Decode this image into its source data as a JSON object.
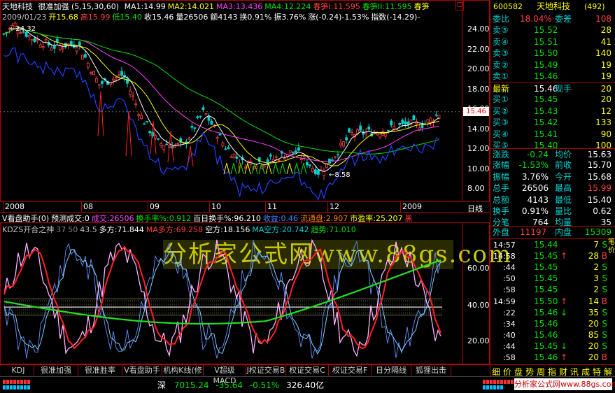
{
  "stock": {
    "name": "天地科技",
    "indicator": "很准加强 (5,15,30,60)",
    "code": "600582",
    "code_count": "(492)",
    "ma": [
      {
        "label": "MA1:14.99",
        "color": "#ffffff"
      },
      {
        "label": "MA2:14.021",
        "color": "#ffff00"
      },
      {
        "label": "MA3:13.436",
        "color": "#ff40ff"
      },
      {
        "label": "MA4:12.224",
        "color": "#00e000"
      },
      {
        "label": "春笋I:11.595",
        "color": "#ff4040"
      },
      {
        "label": "春笋II:11.595",
        "color": "#00e000"
      },
      {
        "label": "春笋",
        "color": "#ffff00"
      }
    ],
    "info_line": [
      {
        "t": "2009/01/23",
        "c": "#c0c0c0"
      },
      {
        "t": "开15.68",
        "c": "#ffff00"
      },
      {
        "t": "高15.99",
        "c": "#ff4040"
      },
      {
        "t": "低15.40",
        "c": "#00e000"
      },
      {
        "t": "收15.46",
        "c": "#ffffff"
      },
      {
        "t": "量26506",
        "c": "#ffffff"
      },
      {
        "t": "额4143",
        "c": "#ffffff"
      },
      {
        "t": "换0.91%",
        "c": "#ffffff"
      },
      {
        "t": "振3.76%",
        "c": "#ffffff"
      },
      {
        "t": "涨(-0.24)-1.53%",
        "c": "#ffffff"
      },
      {
        "t": "指数(-14.29)-",
        "c": "#ffffff"
      }
    ],
    "high_marker": "24.32",
    "low_marker": "8.58",
    "current_price_tag": "15.46",
    "price_ticks": [
      "24.00",
      "22.00",
      "20.00",
      "18.00",
      "16.00",
      "14.00",
      "12.00",
      "10.00",
      "8.00"
    ],
    "date_labels": [
      "2008",
      "08",
      "09",
      "10",
      "11",
      "12",
      "2009"
    ],
    "period_label": "日线",
    "watermark": "分析家公式网www.88gs.com"
  },
  "indicator1": {
    "legend": [
      {
        "t": "V看盘助手(0)",
        "c": "#ffffff"
      },
      {
        "t": "预测成交:0",
        "c": "#ffffff"
      },
      {
        "t": "成交:26506",
        "c": "#ff40ff"
      },
      {
        "t": "换手率%:0.912",
        "c": "#00e000"
      },
      {
        "t": "百日换手%:96.210",
        "c": "#ffffff"
      },
      {
        "t": "收益:0.46",
        "c": "#4080ff"
      },
      {
        "t": "流通盘:2.907",
        "c": "#ff8000"
      },
      {
        "t": "市盈率:25.207",
        "c": "#ffff00"
      },
      {
        "t": "黑",
        "c": "#ff4040"
      }
    ]
  },
  "indicator2": {
    "legend": [
      {
        "t": "KDZS开合之神",
        "c": "#c0c0c0"
      },
      {
        "t": "37",
        "c": "#808080"
      },
      {
        "t": "50",
        "c": "#808080"
      },
      {
        "t": "43.5",
        "c": "#c0c0c0"
      },
      {
        "t": "多方:71.844",
        "c": "#ffffff"
      },
      {
        "t": "MA多方:69.258",
        "c": "#ff4040"
      },
      {
        "t": "空方:18.156",
        "c": "#ffffff"
      },
      {
        "t": "MA空方:20.742",
        "c": "#00d0d0"
      },
      {
        "t": "趋势:71.010",
        "c": "#00e000"
      }
    ],
    "ticks": [
      "60.00",
      "40.00",
      "20.00"
    ]
  },
  "quote": {
    "wei_bi_label": "委比",
    "wei_bi_value": "18.04%",
    "wei_cha_label": "委差",
    "wei_cha_value": "108",
    "sell": [
      {
        "label": "卖⑤",
        "price": "15.52",
        "vol": "28"
      },
      {
        "label": "卖④",
        "price": "15.51",
        "vol": "41"
      },
      {
        "label": "卖③",
        "price": "15.50",
        "vol": "140"
      },
      {
        "label": "卖②",
        "price": "15.49",
        "vol": "19"
      },
      {
        "label": "卖①",
        "price": "15.46",
        "vol": "19"
      }
    ],
    "latest_label": "最新",
    "latest_price": "15.46",
    "xianshou_label": "现手",
    "xianshou_value": "20",
    "buy": [
      {
        "label": "买①",
        "price": "15.45",
        "vol": "20"
      },
      {
        "label": "买②",
        "price": "15.43",
        "vol": "12"
      },
      {
        "label": "买③",
        "price": "15.42",
        "vol": "133"
      },
      {
        "label": "买④",
        "price": "15.41",
        "vol": "90"
      },
      {
        "label": "买⑤",
        "price": "15.40",
        "vol": "100"
      }
    ],
    "stats": [
      {
        "l1": "涨跌",
        "v1": "-0.24",
        "c1": "#00e000",
        "l2": "均价",
        "v2": "15.63",
        "c2": "#ffffff"
      },
      {
        "l1": "涨幅",
        "v1": "-1.53%",
        "c1": "#00e000",
        "l2": "前收",
        "v2": "15.70",
        "c2": "#ffffff"
      },
      {
        "l1": "振幅",
        "v1": "3.76%",
        "c1": "#ffffff",
        "l2": "今开",
        "v2": "15.68",
        "c2": "#ffffff"
      },
      {
        "l1": "总手",
        "v1": "26506",
        "c1": "#ffffff",
        "l2": "最高",
        "v2": "15.99",
        "c2": "#ff4040"
      },
      {
        "l1": "总额",
        "v1": "4143",
        "c1": "#ffffff",
        "l2": "最低",
        "v2": "15.40",
        "c2": "#ffffff"
      },
      {
        "l1": "换手",
        "v1": "0.91%",
        "c1": "#ffffff",
        "l2": "量比",
        "v2": "0.62",
        "c2": "#ffffff"
      },
      {
        "l1": "分笔",
        "v1": "764",
        "c1": "#ffffff",
        "l2": "均量",
        "v2": "35",
        "c2": "#ffffff"
      }
    ],
    "waipan_label": "外盘",
    "waipan_value": "11197",
    "neipan_label": "内盘",
    "neipan_value": "15309",
    "ticks": [
      {
        "time": "14:57",
        "price": "15.44",
        "vol": "7",
        "flag": "S",
        "dir": ""
      },
      {
        "time": "14:58",
        "price": "15.45",
        "vol": "28",
        "flag": "B",
        "dir": "up"
      },
      {
        "time": ":44",
        "price": "15.45",
        "vol": "2",
        "flag": "S",
        "dir": ""
      },
      {
        "time": ":50",
        "price": "15.45",
        "vol": "3",
        "flag": "S",
        "dir": ""
      },
      {
        "time": ":58",
        "price": "15.45",
        "vol": "2",
        "flag": "S",
        "dir": ""
      },
      {
        "time": "14:59",
        "price": "15.50",
        "vol": "14",
        "flag": "B",
        "dir": "up"
      },
      {
        "time": ":22",
        "price": "15.46",
        "vol": "35",
        "flag": "S",
        "dir": "down"
      },
      {
        "time": ":34",
        "price": "15.46",
        "vol": "20",
        "flag": "S",
        "dir": ""
      },
      {
        "time": ":40",
        "price": "15.46",
        "vol": "85",
        "flag": "S",
        "dir": ""
      },
      {
        "time": ":44",
        "price": "15.45",
        "vol": "20",
        "flag": "S",
        "dir": "down"
      },
      {
        "time": ":58",
        "price": "15.46",
        "vol": "20",
        "flag": "B",
        "dir": "up"
      }
    ],
    "side_tabs": "笔价"
  },
  "tabs": [
    "KDJ",
    "很准加强",
    "很准胜率",
    "V看盘助手",
    "机构K线(修",
    "V超级MACD",
    "J权证交易B",
    "权证交易C",
    "权证交易F",
    "日分隔线",
    "狐狸出击"
  ],
  "right_tabs": [
    "细",
    "价",
    "盘",
    "势",
    "周",
    "指",
    "财",
    "讯",
    "成",
    "特",
    "解"
  ],
  "status": {
    "index_name": "深",
    "index_value": "7015.24",
    "index_change": "-35.64",
    "index_pct": "-0.51%",
    "index_amount": "326.40亿",
    "site": "分析家公式网www.88gs.com"
  }
}
